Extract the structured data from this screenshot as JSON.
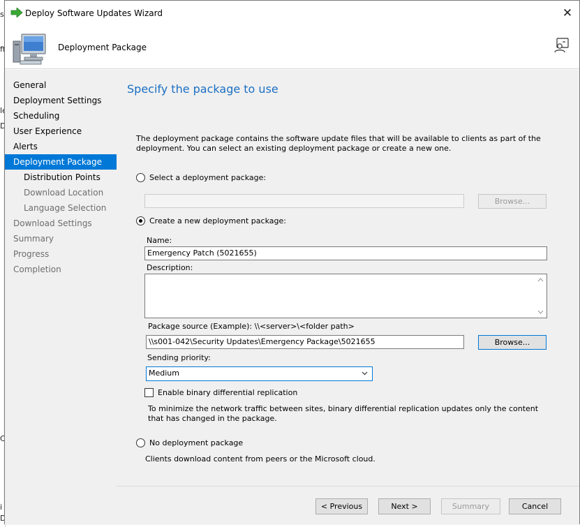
{
  "window": {
    "title": "Deploy Software Updates Wizard",
    "header_title": "Deployment Package",
    "close_glyph": "✕"
  },
  "background_chars": [
    "s",
    "ft",
    "le",
    "D",
    "C",
    "i",
    "D"
  ],
  "nav": [
    {
      "label": "General",
      "state": "normal",
      "level": 0
    },
    {
      "label": "Deployment Settings",
      "state": "normal",
      "level": 0
    },
    {
      "label": "Scheduling",
      "state": "normal",
      "level": 0
    },
    {
      "label": "User Experience",
      "state": "normal",
      "level": 0
    },
    {
      "label": "Alerts",
      "state": "normal",
      "level": 0
    },
    {
      "label": "Deployment Package",
      "state": "active",
      "level": 0
    },
    {
      "label": "Distribution Points",
      "state": "normal",
      "level": 1
    },
    {
      "label": "Download Location",
      "state": "disabled",
      "level": 1
    },
    {
      "label": "Language Selection",
      "state": "disabled",
      "level": 1
    },
    {
      "label": "Download Settings",
      "state": "disabled",
      "level": 0
    },
    {
      "label": "Summary",
      "state": "disabled",
      "level": 0
    },
    {
      "label": "Progress",
      "state": "disabled",
      "level": 0
    },
    {
      "label": "Completion",
      "state": "disabled",
      "level": 0
    }
  ],
  "page": {
    "title": "Specify the package to use",
    "description": "The deployment package contains the software update files that will be available to clients as part of the deployment. You can select an existing deployment package or create a new one.",
    "option_existing": {
      "label": "Select a deployment package:",
      "selected": false,
      "value": "",
      "browse_label": "Browse..."
    },
    "option_new": {
      "label": "Create a new deployment package:",
      "selected": true,
      "name_label": "Name:",
      "name_value": "Emergency Patch (5021655)",
      "description_label": "Description:",
      "description_value": "",
      "source_label": "Package source (Example): \\\\<server>\\<folder path>",
      "source_value": "\\\\s001-042\\Security Updates\\Emergency Package\\5021655",
      "browse_label": "Browse...",
      "priority_label": "Sending priority:",
      "priority_value": "Medium",
      "bdr_label": "Enable binary differential replication",
      "bdr_checked": false,
      "bdr_note": "To minimize the network traffic between sites, binary differential replication updates only the content that has changed in the package."
    },
    "option_none": {
      "label": "No deployment package",
      "selected": false,
      "note": "Clients download content from peers or the Microsoft cloud."
    }
  },
  "footer": {
    "previous": "< Previous",
    "next": "Next >",
    "summary": "Summary",
    "cancel": "Cancel"
  },
  "colors": {
    "accent": "#0078d7",
    "title_blue": "#1a6fc4",
    "panel": "#f0f0f0"
  }
}
